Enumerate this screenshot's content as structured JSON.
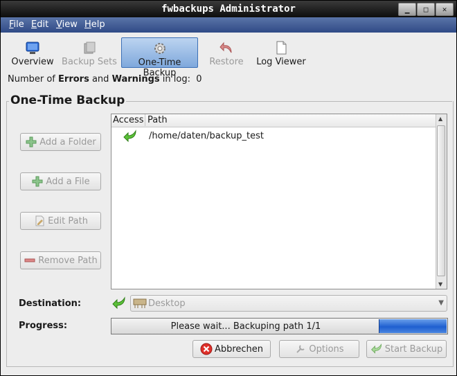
{
  "window": {
    "title": "fwbackups Administrator",
    "min_glyph": "▁",
    "max_glyph": "□",
    "close_glyph": "✕"
  },
  "menu": [
    "File",
    "Edit",
    "View",
    "Help"
  ],
  "toolbar": [
    {
      "label": "Overview",
      "icon": "monitor-icon",
      "state": "normal"
    },
    {
      "label": "Backup Sets",
      "icon": "backup-sets-icon",
      "state": "disabled"
    },
    {
      "label": "One-Time Backup",
      "icon": "gear-icon",
      "state": "active"
    },
    {
      "label": "Restore",
      "icon": "undo-arrow-icon",
      "state": "disabled"
    },
    {
      "label": "Log Viewer",
      "icon": "document-icon",
      "state": "normal"
    }
  ],
  "log_status": {
    "prefix": "Number of ",
    "errors": "Errors",
    "and": " and ",
    "warnings": "Warnings",
    "suffix": " in log:",
    "count": "0"
  },
  "section": {
    "title": "One-Time Backup"
  },
  "side_buttons": [
    "Add a Folder",
    "Add a File",
    "Edit Path",
    "Remove Path"
  ],
  "table": {
    "columns": [
      "Access",
      "Path"
    ],
    "rows": [
      {
        "access_icon": "green-arrow-icon",
        "path": "/home/daten/backup_test"
      }
    ]
  },
  "destination": {
    "label": "Destination:",
    "value": "Desktop"
  },
  "progress": {
    "label": "Progress:",
    "text": "Please wait... Backuping path 1/1",
    "fraction": 0.2
  },
  "actions": {
    "cancel": "Abbrechen",
    "options": "Options",
    "start": "Start Backup"
  },
  "colors": {
    "accent": "#3b6fb6",
    "menubar": "#3f5b94",
    "progress_fill": "#1f5fd0"
  }
}
